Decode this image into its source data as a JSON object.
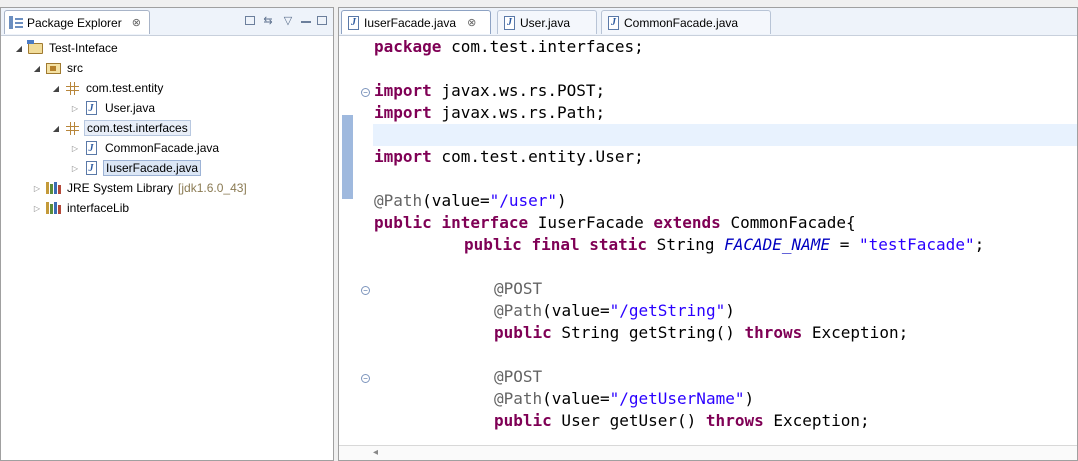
{
  "explorer": {
    "tab_label": "Package Explorer",
    "close_glyph": "⊗",
    "tree": [
      {
        "label": "Test-Inteface",
        "icon": "project-icon"
      },
      {
        "label": "src",
        "icon": "source-folder-icon"
      },
      {
        "label": "com.test.entity",
        "icon": "package-icon"
      },
      {
        "label": "User.java",
        "icon": "java-file-icon"
      },
      {
        "label": "com.test.interfaces",
        "icon": "package-icon"
      },
      {
        "label": "CommonFacade.java",
        "icon": "java-file-icon"
      },
      {
        "label": "IuserFacade.java",
        "icon": "java-file-icon"
      },
      {
        "label": "JRE System Library",
        "suffix": "[jdk1.6.0_43]",
        "icon": "library-icon"
      },
      {
        "label": "interfaceLib",
        "icon": "library-icon"
      }
    ]
  },
  "editor": {
    "tabs": [
      {
        "label": "IuserFacade.java",
        "close": "⊗"
      },
      {
        "label": "User.java"
      },
      {
        "label": "CommonFacade.java"
      }
    ],
    "code": {
      "l1_kw": "package",
      "l1_rest": " com.test.interfaces;",
      "l3_kw": "import",
      "l3_rest": " javax.ws.rs.POST;",
      "l4_kw": "import",
      "l4_rest": " javax.ws.rs.Path;",
      "l6_kw": "import",
      "l6_rest": " com.test.entity.User;",
      "l8_ann": "@Path",
      "l8_a": "(value=",
      "l8_str": "\"/user\"",
      "l8_b": ")",
      "l9_kw1": "public",
      "l9_kw2": "interface",
      "l9_a": " IuserFacade ",
      "l9_kw3": "extends",
      "l9_b": " CommonFacade{",
      "l10_kw1": "public",
      "l10_kw2": "final",
      "l10_kw3": "static",
      "l10_a": " String ",
      "l10_fld": "FACADE_NAME",
      "l10_b": " = ",
      "l10_str": "\"testFacade\"",
      "l10_c": ";",
      "l12_ann": "@POST",
      "l13_ann": "@Path",
      "l13_a": "(value=",
      "l13_str": "\"/getString\"",
      "l13_b": ")",
      "l14_kw1": "public",
      "l14_a": " String getString() ",
      "l14_kw2": "throws",
      "l14_b": " Exception;",
      "l16_ann": "@POST",
      "l17_ann": "@Path",
      "l17_a": "(value=",
      "l17_str": "\"/getUserName\"",
      "l17_b": ")",
      "l18_kw1": "public",
      "l18_a": " User getUser() ",
      "l18_kw2": "throws",
      "l18_b": " Exception;"
    }
  }
}
